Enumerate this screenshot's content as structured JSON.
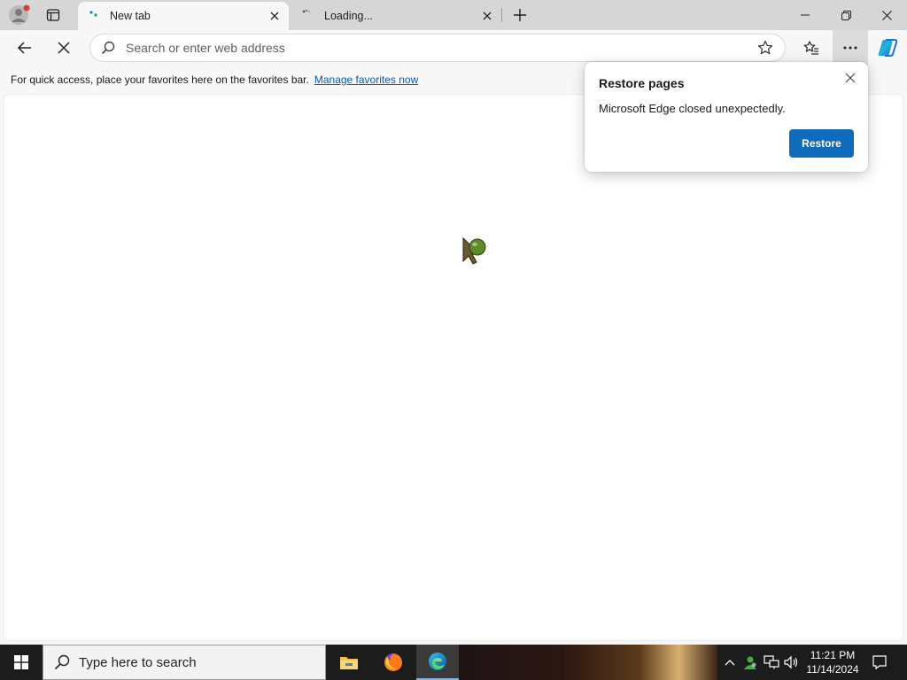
{
  "browser": {
    "tabs": [
      {
        "title": "New tab",
        "active": true
      },
      {
        "title": "Loading...",
        "active": false
      }
    ],
    "address_placeholder": "Search or enter web address",
    "favorites_bar": {
      "message": "For quick access, place your favorites here on the favorites bar.",
      "link": "Manage favorites now"
    }
  },
  "popup": {
    "title": "Restore pages",
    "message": "Microsoft Edge closed unexpectedly.",
    "button": "Restore"
  },
  "taskbar": {
    "search_placeholder": "Type here to search",
    "time": "11:21 PM",
    "date": "11/14/2024"
  },
  "colors": {
    "accent": "#0f6cbd",
    "link": "#0b5cad",
    "tabbar": "#d6d6d6",
    "taskbar": "#1c1c1c"
  },
  "icons": [
    "profile-icon",
    "tab-actions-icon",
    "newtab-favicon-icon",
    "loading-favicon-icon",
    "close-icon",
    "plus-icon",
    "minimize-icon",
    "restore-icon",
    "back-icon",
    "stop-icon",
    "search-icon",
    "star-icon",
    "favorites-icon",
    "more-icon",
    "copilot-icon",
    "windows-icon",
    "file-explorer-icon",
    "firefox-icon",
    "edge-icon",
    "chevron-up-icon",
    "people-icon",
    "network-icon",
    "volume-icon",
    "notification-icon"
  ]
}
